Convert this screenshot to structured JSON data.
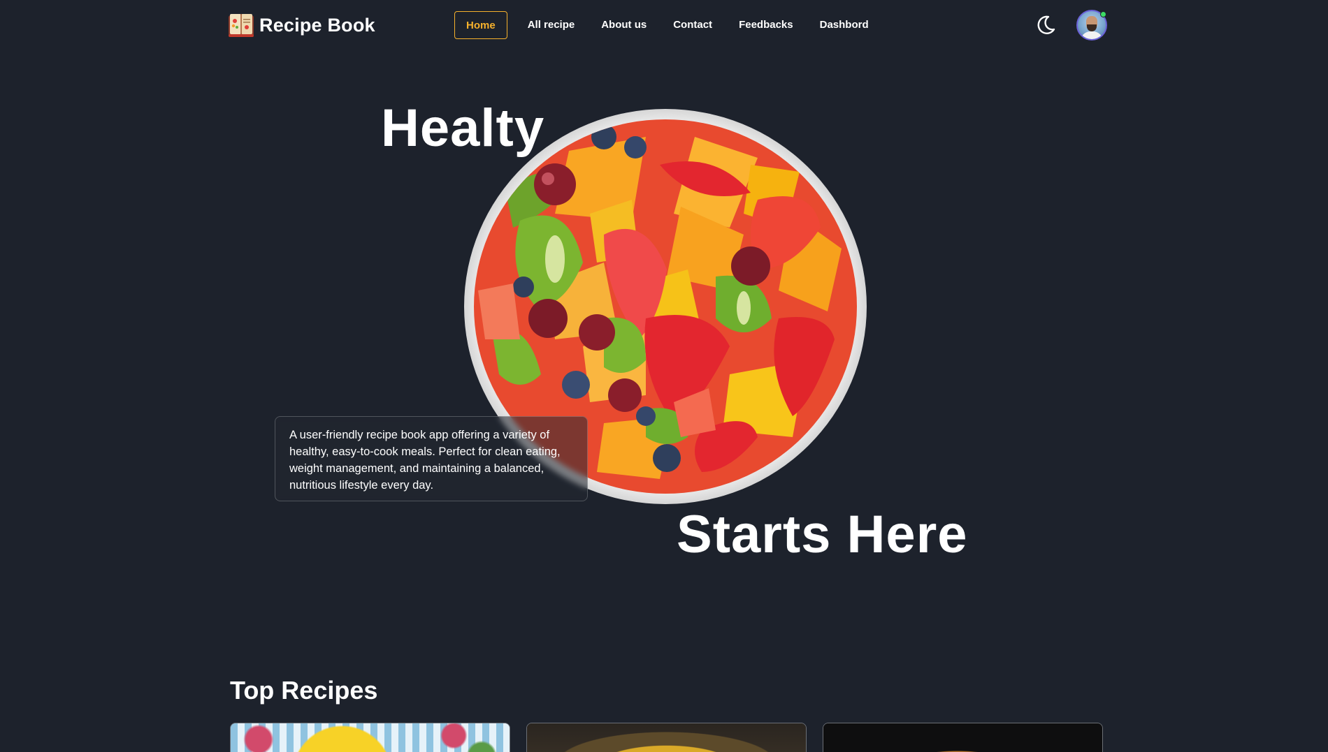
{
  "navbar": {
    "brand_name": "Recipe Book",
    "links": [
      {
        "label": "Home",
        "active": true
      },
      {
        "label": "All recipe",
        "active": false
      },
      {
        "label": "About us",
        "active": false
      },
      {
        "label": "Contact",
        "active": false
      },
      {
        "label": "Feedbacks",
        "active": false
      },
      {
        "label": "Dashbord",
        "active": false
      }
    ],
    "theme_icon": "moon-icon",
    "avatar_status": "online"
  },
  "hero": {
    "title_top": "Healty",
    "title_bottom": "Starts Here",
    "description": "A user-friendly recipe book app offering a variety of healthy, easy-to-cook meals. Perfect for clean eating, weight management, and maintaining a balanced, nutritious lifestyle every day.",
    "image": "fruit-salad-bowl"
  },
  "top_recipes": {
    "title": "Top Recipes",
    "cards": [
      {
        "image": "recipe-image-1"
      },
      {
        "image": "recipe-image-2"
      },
      {
        "image": "recipe-image-3"
      }
    ]
  },
  "colors": {
    "background": "#1d222c",
    "accent": "#f6b12c",
    "text": "#ffffff",
    "avatar_ring": "#6b62d9",
    "online": "#3ddc65"
  }
}
